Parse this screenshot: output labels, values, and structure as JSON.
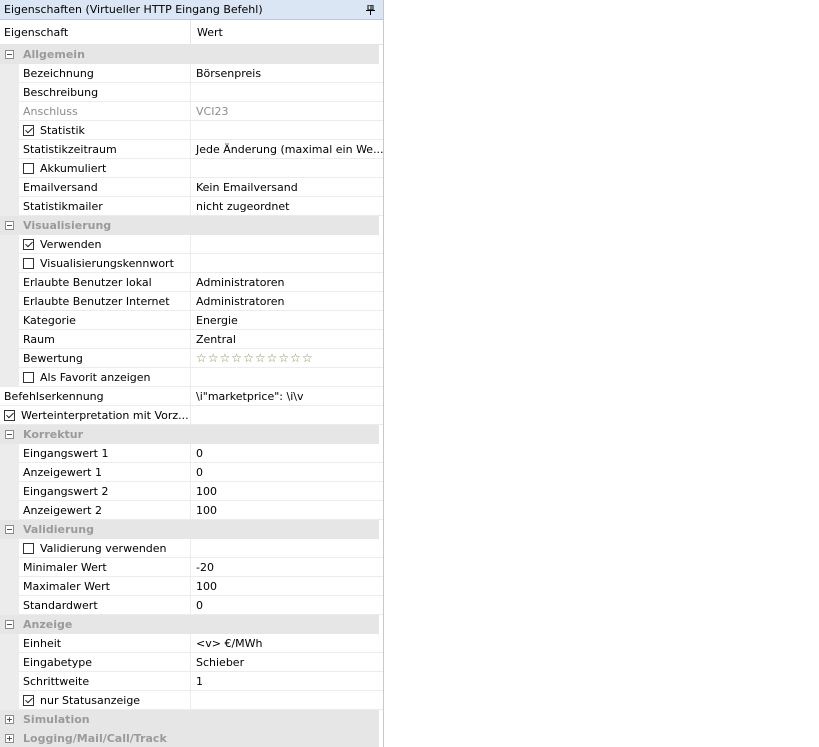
{
  "title": "Eigenschaften (Virtueller HTTP Eingang Befehl)",
  "pin_icon": "pin-icon",
  "header": {
    "col1": "Eigenschaft",
    "col2": "Wert"
  },
  "rows": [
    {
      "type": "cat",
      "label": "Allgemein",
      "expanded": true
    },
    {
      "type": "prop",
      "label": "Bezeichnung",
      "value": "Börsenpreis",
      "indent": true
    },
    {
      "type": "prop",
      "label": "Beschreibung",
      "value": "",
      "indent": true
    },
    {
      "type": "prop",
      "label": "Anschluss",
      "value": "VCI23",
      "indent": true,
      "disabled": true
    },
    {
      "type": "check",
      "label": "Statistik",
      "checked": true,
      "indent": true,
      "value": ""
    },
    {
      "type": "prop",
      "label": "Statistikzeitraum",
      "value": "Jede Änderung (maximal ein We...",
      "indent": true
    },
    {
      "type": "check",
      "label": "Akkumuliert",
      "checked": false,
      "indent": true,
      "value": ""
    },
    {
      "type": "prop",
      "label": "Emailversand",
      "value": "Kein Emailversand",
      "indent": true
    },
    {
      "type": "prop",
      "label": "Statistikmailer",
      "value": "nicht zugeordnet",
      "indent": true
    },
    {
      "type": "cat",
      "label": "Visualisierung",
      "expanded": true
    },
    {
      "type": "check",
      "label": "Verwenden",
      "checked": true,
      "indent": true,
      "value": ""
    },
    {
      "type": "check",
      "label": "Visualisierungskennwort",
      "checked": false,
      "indent": true,
      "value": ""
    },
    {
      "type": "prop",
      "label": "Erlaubte Benutzer lokal",
      "value": "Administratoren",
      "indent": true
    },
    {
      "type": "prop",
      "label": "Erlaubte Benutzer Internet",
      "value": "Administratoren",
      "indent": true
    },
    {
      "type": "prop",
      "label": "Kategorie",
      "value": "Energie",
      "indent": true
    },
    {
      "type": "prop",
      "label": "Raum",
      "value": "Zentral",
      "indent": true
    },
    {
      "type": "stars",
      "label": "Bewertung",
      "rating": 0,
      "max": 10,
      "indent": true
    },
    {
      "type": "check",
      "label": "Als Favorit anzeigen",
      "checked": false,
      "indent": true,
      "value": ""
    },
    {
      "type": "prop",
      "label": "Befehlserkennung",
      "value": "\\i\"marketprice\": \\i\\v",
      "indent": false
    },
    {
      "type": "check",
      "label": "Werteinterpretation mit Vorz...",
      "checked": true,
      "indent": false,
      "value": ""
    },
    {
      "type": "cat",
      "label": "Korrektur",
      "expanded": true
    },
    {
      "type": "prop",
      "label": "Eingangswert 1",
      "value": "0",
      "indent": true
    },
    {
      "type": "prop",
      "label": "Anzeigewert 1",
      "value": "0",
      "indent": true
    },
    {
      "type": "prop",
      "label": "Eingangswert 2",
      "value": "100",
      "indent": true
    },
    {
      "type": "prop",
      "label": "Anzeigewert 2",
      "value": "100",
      "indent": true
    },
    {
      "type": "cat",
      "label": "Validierung",
      "expanded": true
    },
    {
      "type": "check",
      "label": "Validierung verwenden",
      "checked": false,
      "indent": true,
      "value": ""
    },
    {
      "type": "prop",
      "label": "Minimaler Wert",
      "value": "-20",
      "indent": true
    },
    {
      "type": "prop",
      "label": "Maximaler Wert",
      "value": "100",
      "indent": true
    },
    {
      "type": "prop",
      "label": "Standardwert",
      "value": "0",
      "indent": true
    },
    {
      "type": "cat",
      "label": "Anzeige",
      "expanded": true
    },
    {
      "type": "prop",
      "label": "Einheit",
      "value": "<v> €/MWh",
      "indent": true
    },
    {
      "type": "prop",
      "label": "Eingabetype",
      "value": "Schieber",
      "indent": true
    },
    {
      "type": "prop",
      "label": "Schrittweite",
      "value": "1",
      "indent": true
    },
    {
      "type": "check",
      "label": "nur Statusanzeige",
      "checked": true,
      "indent": true,
      "value": ""
    },
    {
      "type": "cat",
      "label": "Simulation",
      "expanded": false
    },
    {
      "type": "cat",
      "label": "Logging/Mail/Call/Track",
      "expanded": false
    }
  ]
}
